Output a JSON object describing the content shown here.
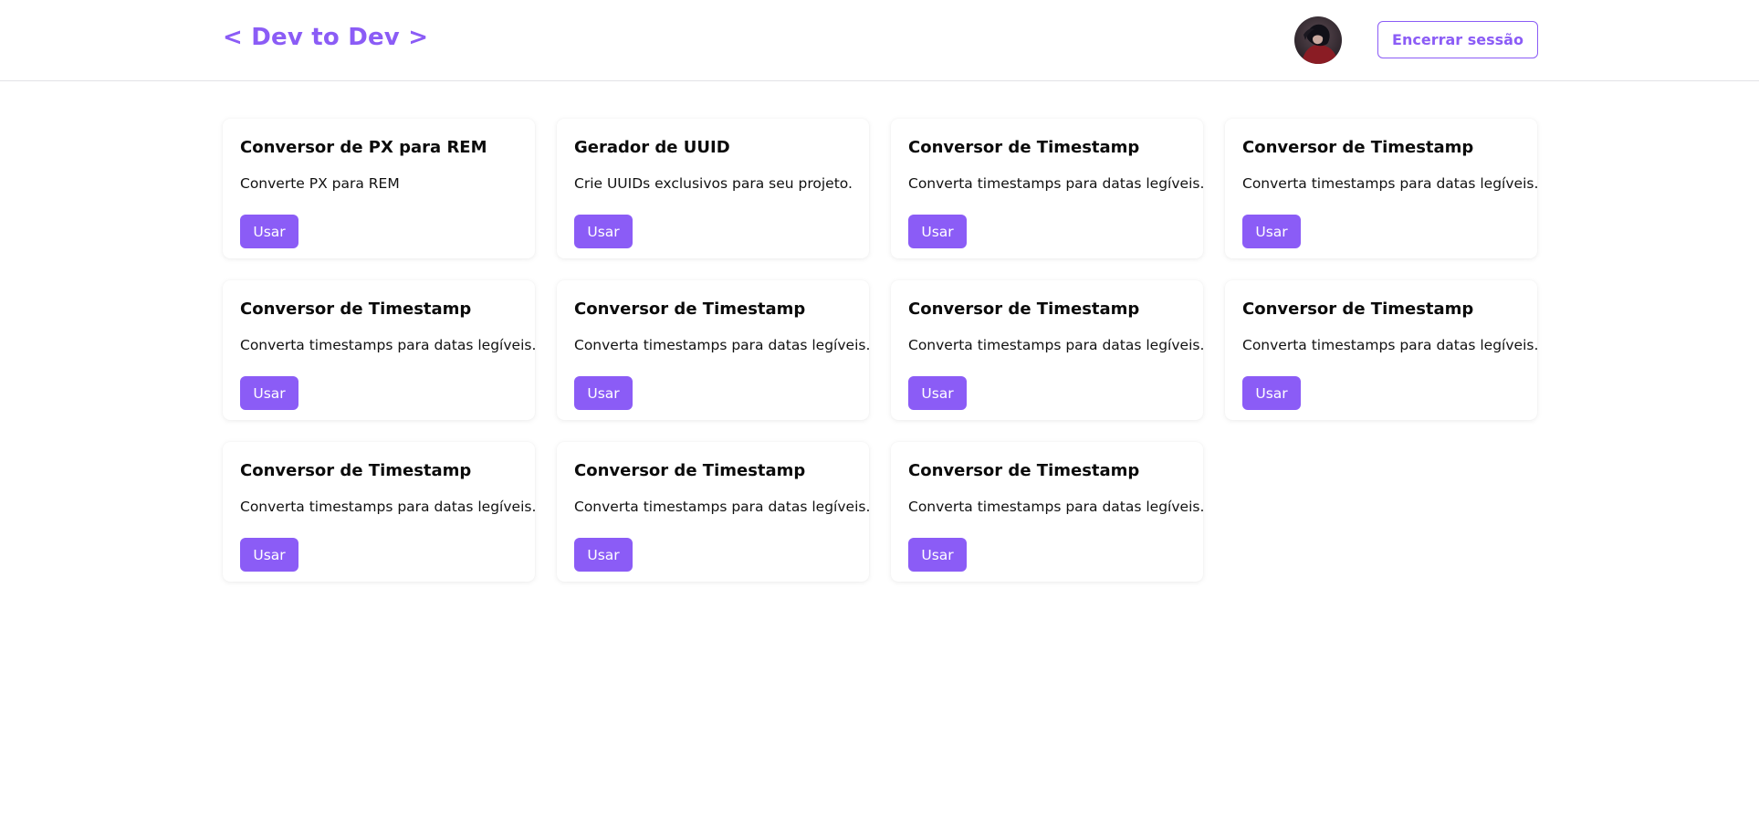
{
  "header": {
    "brand": "< Dev to Dev >",
    "logout_label": "Encerrar sessão",
    "avatar_icon": "user-avatar"
  },
  "colors": {
    "accent": "#8b5cf6",
    "background": "#ffffff",
    "border": "#e2e2e6"
  },
  "tools": [
    {
      "title": "Conversor de PX para REM",
      "description": "Converte PX para REM",
      "button": "Usar"
    },
    {
      "title": "Gerador de UUID",
      "description": "Crie UUIDs exclusivos para seu projeto.",
      "button": "Usar"
    },
    {
      "title": "Conversor de Timestamp",
      "description": "Converta timestamps para datas legíveis.",
      "button": "Usar"
    },
    {
      "title": "Conversor de Timestamp",
      "description": "Converta timestamps para datas legíveis.",
      "button": "Usar"
    },
    {
      "title": "Conversor de Timestamp",
      "description": "Converta timestamps para datas legíveis.",
      "button": "Usar"
    },
    {
      "title": "Conversor de Timestamp",
      "description": "Converta timestamps para datas legíveis.",
      "button": "Usar"
    },
    {
      "title": "Conversor de Timestamp",
      "description": "Converta timestamps para datas legíveis.",
      "button": "Usar"
    },
    {
      "title": "Conversor de Timestamp",
      "description": "Converta timestamps para datas legíveis.",
      "button": "Usar"
    },
    {
      "title": "Conversor de Timestamp",
      "description": "Converta timestamps para datas legíveis.",
      "button": "Usar"
    },
    {
      "title": "Conversor de Timestamp",
      "description": "Converta timestamps para datas legíveis.",
      "button": "Usar"
    },
    {
      "title": "Conversor de Timestamp",
      "description": "Converta timestamps para datas legíveis.",
      "button": "Usar"
    }
  ]
}
